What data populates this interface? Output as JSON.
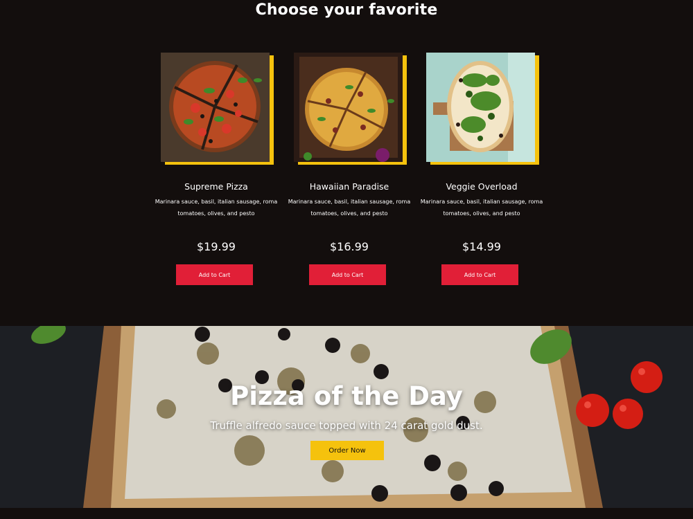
{
  "menu": {
    "title": "Choose your favorite",
    "items": [
      {
        "name": "Supreme Pizza",
        "description": "Marinara sauce, basil, italian sausage, roma tomatoes, olives, and pesto",
        "price": "$19.99",
        "cart_label": "Add to Cart"
      },
      {
        "name": "Hawaiian Paradise",
        "description": "Marinara sauce, basil, italian sausage, roma tomatoes, olives, and pesto",
        "price": "$16.99",
        "cart_label": "Add to Cart"
      },
      {
        "name": "Veggie Overload",
        "description": "Marinara sauce, basil, italian sausage, roma tomatoes, olives, and pesto",
        "price": "$14.99",
        "cart_label": "Add to Cart"
      }
    ]
  },
  "hero": {
    "title": "Pizza of the Day",
    "subtitle": "Truffle alfredo sauce topped with 24 carat gold dust.",
    "order_label": "Order Now"
  },
  "colors": {
    "background": "#130e0d",
    "accent_yellow": "#f5c20d",
    "button_red": "#e11f37"
  }
}
